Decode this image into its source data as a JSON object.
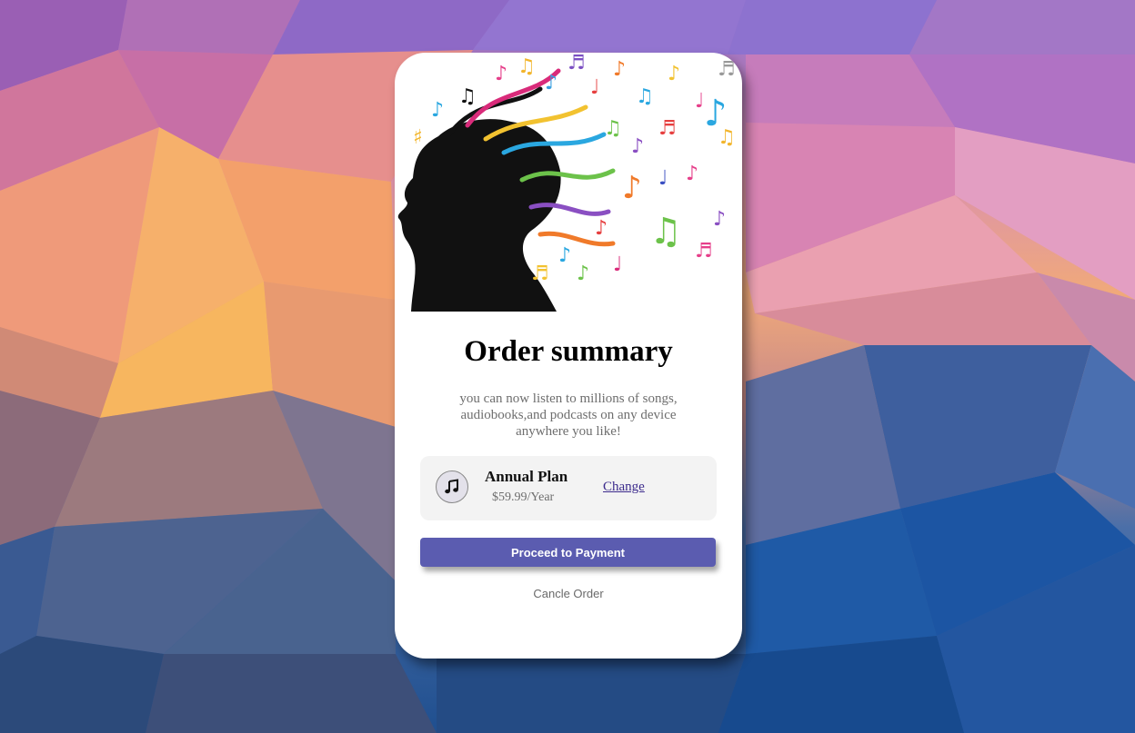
{
  "card": {
    "title": "Order summary",
    "description_lines": [
      "you can now listen to millions of songs,",
      "audiobooks,and podcasts on any device",
      "anywhere you like!"
    ]
  },
  "plan": {
    "name": "Annual Plan",
    "price": "$59.99/Year",
    "change_label": "Change",
    "icon": "music-note-icon"
  },
  "actions": {
    "proceed_label": "Proceed to Payment",
    "cancel_label": "Cancle Order"
  },
  "colors": {
    "primary_button": "#5b5cb0",
    "card_background": "#ffffff",
    "plan_box_background": "#f3f3f3",
    "link": "#3b2a8c"
  }
}
